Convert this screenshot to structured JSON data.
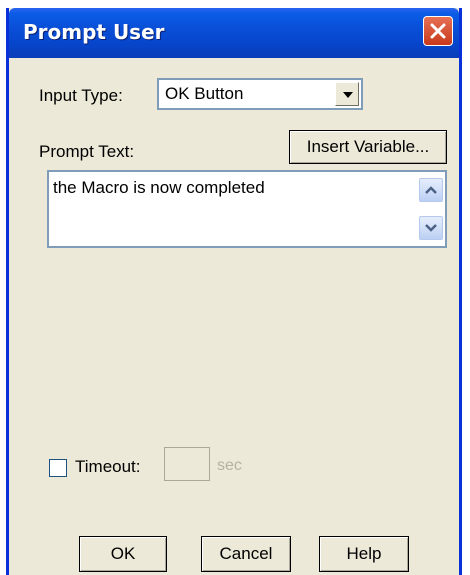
{
  "window": {
    "title": "Prompt User"
  },
  "input_type": {
    "label": "Input Type:",
    "value": "OK Button"
  },
  "prompt_text": {
    "label": "Prompt Text:",
    "insert_variable_label": "Insert Variable...",
    "value": "the Macro is now completed"
  },
  "timeout": {
    "checkbox_checked": false,
    "label": "Timeout:",
    "value": "",
    "unit": "sec"
  },
  "buttons": {
    "ok": "OK",
    "cancel": "Cancel",
    "help": "Help"
  },
  "icons": {
    "close": "close-icon",
    "dropdown": "chevron-down-icon",
    "scroll_up": "chevron-up-icon",
    "scroll_down": "chevron-down-icon"
  },
  "colors": {
    "titlebar": "#0a4fd8",
    "background": "#ece9d8",
    "close": "#c8391a"
  }
}
